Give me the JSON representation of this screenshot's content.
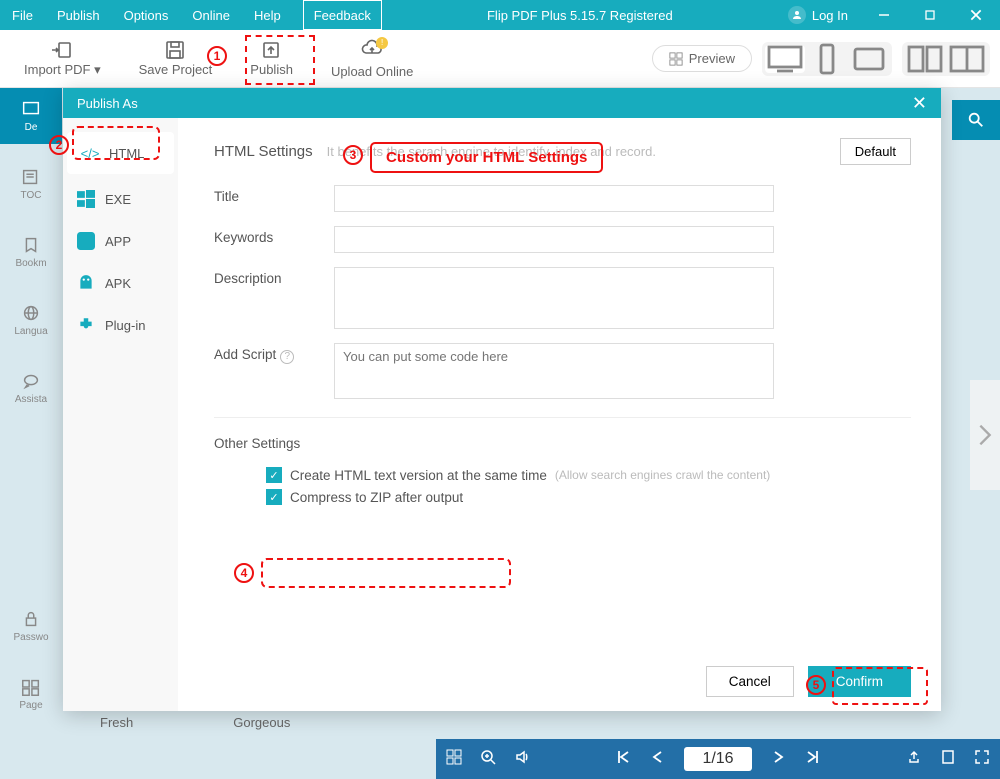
{
  "app": {
    "title": "Flip PDF Plus 5.15.7 Registered"
  },
  "menu": [
    "File",
    "Publish",
    "Options",
    "Online",
    "Help"
  ],
  "feedback": "Feedback",
  "login": "Log In",
  "toolbar": {
    "import": "Import PDF ▾",
    "save": "Save Project",
    "publish": "Publish",
    "upload": "Upload Online",
    "preview": "Preview"
  },
  "leftIcons": [
    "De",
    "TOC",
    "Bookm",
    "Langua",
    "Assista",
    "Passwo",
    "Page"
  ],
  "templates": [
    "Fresh",
    "Gorgeous"
  ],
  "pager": "1/16",
  "dialog": {
    "title": "Publish As",
    "side": [
      "HTML",
      "EXE",
      "APP",
      "APK",
      "Plug-in"
    ],
    "heading": "HTML Settings",
    "hint": "It benefits the serach engine to identify, index and record.",
    "default": "Default",
    "fields": {
      "title": "Title",
      "keywords": "Keywords",
      "description": "Description",
      "addscript": "Add Script",
      "scriptPH": "You can put some code here"
    },
    "other": "Other Settings",
    "check1": "Create HTML text version at the same time",
    "check1hint": "(Allow search engines crawl the content)",
    "check2": "Compress to ZIP after output",
    "cancel": "Cancel",
    "confirm": "Confirm"
  },
  "annot": {
    "callout": "Custom your HTML Settings"
  }
}
